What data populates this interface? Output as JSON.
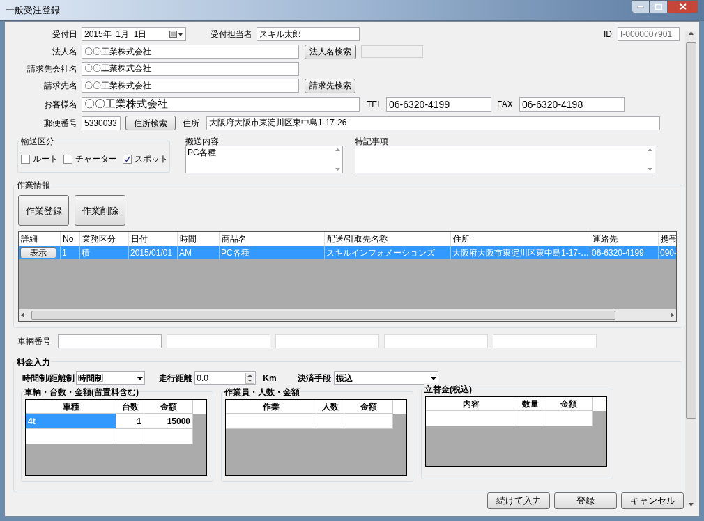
{
  "window": {
    "title": "一般受注登録"
  },
  "id": {
    "label": "ID",
    "value": "I-0000007901"
  },
  "form": {
    "reception_date": {
      "label": "受付日",
      "value": "2015年  1月  1日"
    },
    "reception_staff": {
      "label": "受付担当者",
      "value": "スキル太郎"
    },
    "corporation": {
      "label": "法人名",
      "value": "〇〇工業株式会社",
      "button": "法人名検索"
    },
    "billing_company": {
      "label": "請求先会社名",
      "value": "〇〇工業株式会社"
    },
    "billing_name": {
      "label": "請求先名",
      "value": "〇〇工業株式会社",
      "button": "請求先検索"
    },
    "customer": {
      "label": "お客様名",
      "value": "〇〇工業株式会社"
    },
    "tel": {
      "label": "TEL",
      "value": "06-6320-4199"
    },
    "fax": {
      "label": "FAX",
      "value": "06-6320-4198"
    },
    "postal": {
      "label": "郵便番号",
      "value": "5330033",
      "button": "住所検索"
    },
    "address": {
      "label": "住所",
      "value": "大阪府大阪市東淀川区東中島1-17-26"
    }
  },
  "transport": {
    "title": "輸送区分",
    "options": [
      {
        "label": "ルート",
        "checked": false
      },
      {
        "label": "チャーター",
        "checked": false
      },
      {
        "label": "スポット",
        "checked": true
      }
    ]
  },
  "cargo": {
    "label": "搬送内容",
    "value": "PC各種"
  },
  "notes": {
    "label": "特記事項"
  },
  "work": {
    "title": "作業情報",
    "buttons": [
      "作業登録",
      "作業削除"
    ],
    "table": {
      "columns": [
        "詳細",
        "No",
        "業務区分",
        "日付",
        "時間",
        "商品名",
        "配送/引取先名称",
        "住所",
        "連絡先",
        "携帯"
      ],
      "rows": [
        {
          "selected": true,
          "cells": [
            "表示",
            "1",
            "積",
            "2015/01/01",
            "AM",
            "PC各種",
            "スキルインフォメーションズ",
            "大阪府大阪市東淀川区東中島1-17-…",
            "06-6320-4199",
            "090-"
          ]
        }
      ]
    }
  },
  "vehicle_numbers": {
    "label": "車輌番号"
  },
  "fee": {
    "title": "料金入力",
    "billing_mode": {
      "label": "時間制/距離制",
      "value": "時間制"
    },
    "distance": {
      "label": "走行距離",
      "value": "0.0",
      "unit": "Km"
    },
    "payment": {
      "label": "決済手段",
      "value": "振込"
    }
  },
  "grids": [
    {
      "title": "車輌・台数・金額(留置料含む)",
      "columns": [
        "車種",
        "台数",
        "金額"
      ],
      "rows": [
        {
          "selected": true,
          "cells": [
            "4t",
            "1",
            "15000"
          ]
        }
      ]
    },
    {
      "title": "作業員・人数・金額",
      "columns": [
        "作業",
        "人数",
        "金額"
      ]
    },
    {
      "title": "立替金(税込)",
      "columns": [
        "内容",
        "数量",
        "金額"
      ]
    }
  ],
  "buttons": [
    "続けて入力",
    "登録",
    "キャンセル"
  ]
}
